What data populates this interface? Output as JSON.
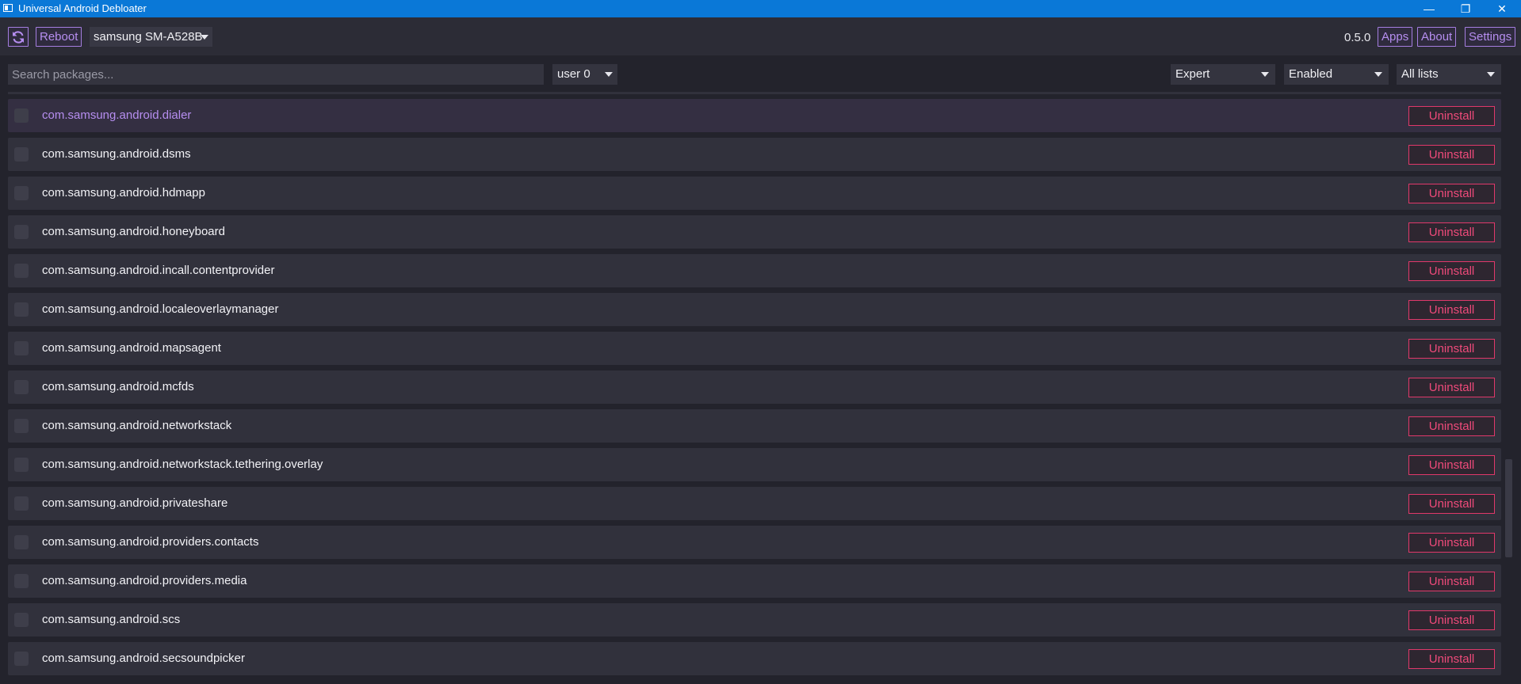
{
  "window": {
    "title": "Universal Android Debloater",
    "minimize_glyph": "—",
    "maximize_glyph": "❐",
    "close_glyph": "✕"
  },
  "toolbar": {
    "refresh_icon": "refresh-icon",
    "reboot_label": "Reboot",
    "device": "samsung SM-A528B",
    "version": "0.5.0",
    "apps_label": "Apps",
    "about_label": "About",
    "settings_label": "Settings"
  },
  "filters": {
    "search_placeholder": "Search packages...",
    "user": "user 0",
    "removal": "Expert",
    "state": "Enabled",
    "list": "All lists"
  },
  "packages": {
    "uninstall_label": "Uninstall",
    "selected_index": 0,
    "items": [
      "com.samsung.android.dialer",
      "com.samsung.android.dsms",
      "com.samsung.android.hdmapp",
      "com.samsung.android.honeyboard",
      "com.samsung.android.incall.contentprovider",
      "com.samsung.android.localeoverlaymanager",
      "com.samsung.android.mapsagent",
      "com.samsung.android.mcfds",
      "com.samsung.android.networkstack",
      "com.samsung.android.networkstack.tethering.overlay",
      "com.samsung.android.privateshare",
      "com.samsung.android.providers.contacts",
      "com.samsung.android.providers.media",
      "com.samsung.android.scs",
      "com.samsung.android.secsoundpicker"
    ]
  },
  "colors": {
    "accent_purple": "#b68ef0",
    "uninstall_red": "#ef4a7a",
    "titlebar_blue": "#0a78d7"
  }
}
